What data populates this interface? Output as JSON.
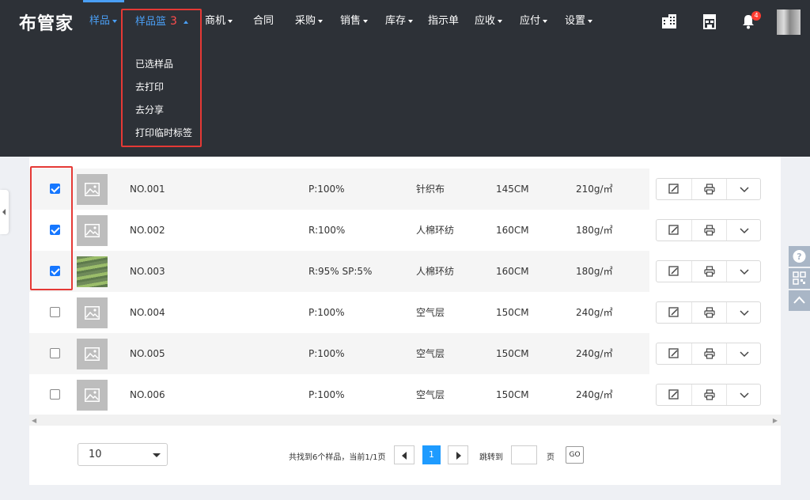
{
  "app": {
    "logo": "布管家"
  },
  "nav": {
    "items": [
      {
        "label": "样品",
        "dropdown": true,
        "active": true
      },
      {
        "label": "样品篮",
        "dropdown": true,
        "open": true,
        "count": "3"
      },
      {
        "label": "商机",
        "dropdown": true
      },
      {
        "label": "合同",
        "dropdown": false
      },
      {
        "label": "采购",
        "dropdown": true
      },
      {
        "label": "销售",
        "dropdown": true
      },
      {
        "label": "库存",
        "dropdown": true
      },
      {
        "label": "指示单",
        "dropdown": false
      },
      {
        "label": "应收",
        "dropdown": true
      },
      {
        "label": "应付",
        "dropdown": true
      },
      {
        "label": "设置",
        "dropdown": true
      }
    ],
    "icons": [
      "building-icon",
      "store-icon",
      "bell-icon",
      "avatar"
    ],
    "bell_badge": "4",
    "accent": "#4a9ff5"
  },
  "basket_menu": {
    "items": [
      "已选样品",
      "去打印",
      "去分享",
      "打印临时标签"
    ]
  },
  "table": {
    "rows": [
      {
        "checked": true,
        "image": "placeholder-image",
        "code": "NO.001",
        "composition": "P:100%",
        "type": "针织布",
        "width": "145CM",
        "weight": "210g/㎡"
      },
      {
        "checked": true,
        "image": "placeholder-image",
        "code": "NO.002",
        "composition": "R:100%",
        "type": "人棉环纺",
        "width": "160CM",
        "weight": "180g/㎡"
      },
      {
        "checked": true,
        "image": "fabric-photo",
        "code": "NO.003",
        "composition": "R:95% SP:5%",
        "type": "人棉环纺",
        "width": "160CM",
        "weight": "180g/㎡"
      },
      {
        "checked": false,
        "image": "placeholder-image",
        "code": "NO.004",
        "composition": "P:100%",
        "type": "空气层",
        "width": "150CM",
        "weight": "240g/㎡"
      },
      {
        "checked": false,
        "image": "placeholder-image",
        "code": "NO.005",
        "composition": "P:100%",
        "type": "空气层",
        "width": "150CM",
        "weight": "240g/㎡"
      },
      {
        "checked": false,
        "image": "placeholder-image",
        "code": "NO.006",
        "composition": "P:100%",
        "type": "空气层",
        "width": "150CM",
        "weight": "240g/㎡"
      }
    ],
    "row_actions": [
      "edit-icon",
      "print-icon",
      "chevron-down-icon"
    ]
  },
  "pagination": {
    "page_size": "10",
    "summary": "共找到6个样品，当前1/1页",
    "current_page": "1",
    "jump_label": "跳转到",
    "page_unit": "页",
    "go_label": "GO"
  },
  "side": {
    "float_icons": [
      "help-icon",
      "qr-code-icon",
      "back-to-top-icon"
    ]
  }
}
